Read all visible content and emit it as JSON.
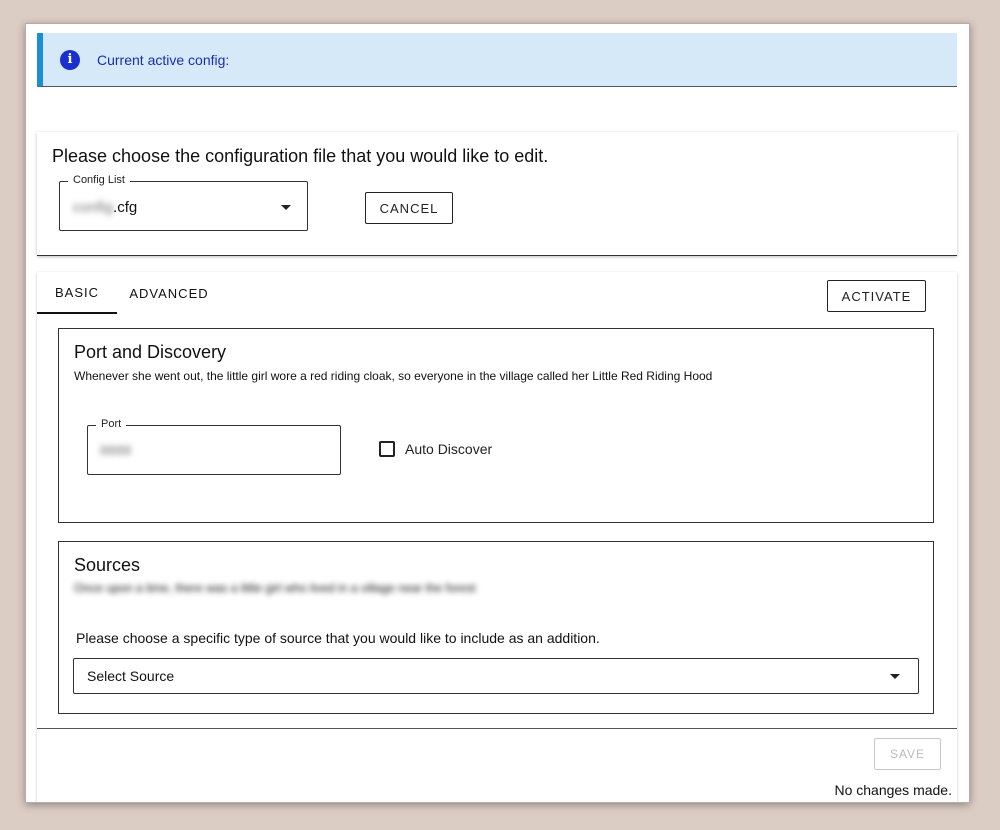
{
  "banner": {
    "icon": "info-icon",
    "icon_glyph": "i",
    "text": "Current active config:"
  },
  "config": {
    "title": "Please choose the configuration file that you would like to edit.",
    "list_label": "Config List",
    "selected_prefix": "config",
    "selected_suffix": ".cfg",
    "cancel_label": "CANCEL"
  },
  "tabs": [
    {
      "label": "BASIC",
      "active": true
    },
    {
      "label": "ADVANCED",
      "active": false
    }
  ],
  "activate_label": "ACTIVATE",
  "port_section": {
    "title": "Port and Discovery",
    "description": "Whenever she went out, the little girl wore a red riding cloak, so everyone in the village called her Little Red Riding Hood",
    "port_label": "Port",
    "port_value": "8888",
    "auto_discover_label": "Auto Discover",
    "auto_discover_checked": false
  },
  "sources_section": {
    "title": "Sources",
    "description": "Once upon a time, there was a little girl who lived in a village near the forest",
    "prompt": "Please choose a specific type of source that you would like to include as an addition.",
    "select_placeholder": "Select Source"
  },
  "footer": {
    "save_label": "SAVE",
    "status": "No changes made."
  },
  "colors": {
    "banner_bg": "#d6e9f8",
    "banner_accent": "#1a8fd6",
    "info_icon": "#1a2fd0",
    "page_bg": "#dccdc4"
  }
}
